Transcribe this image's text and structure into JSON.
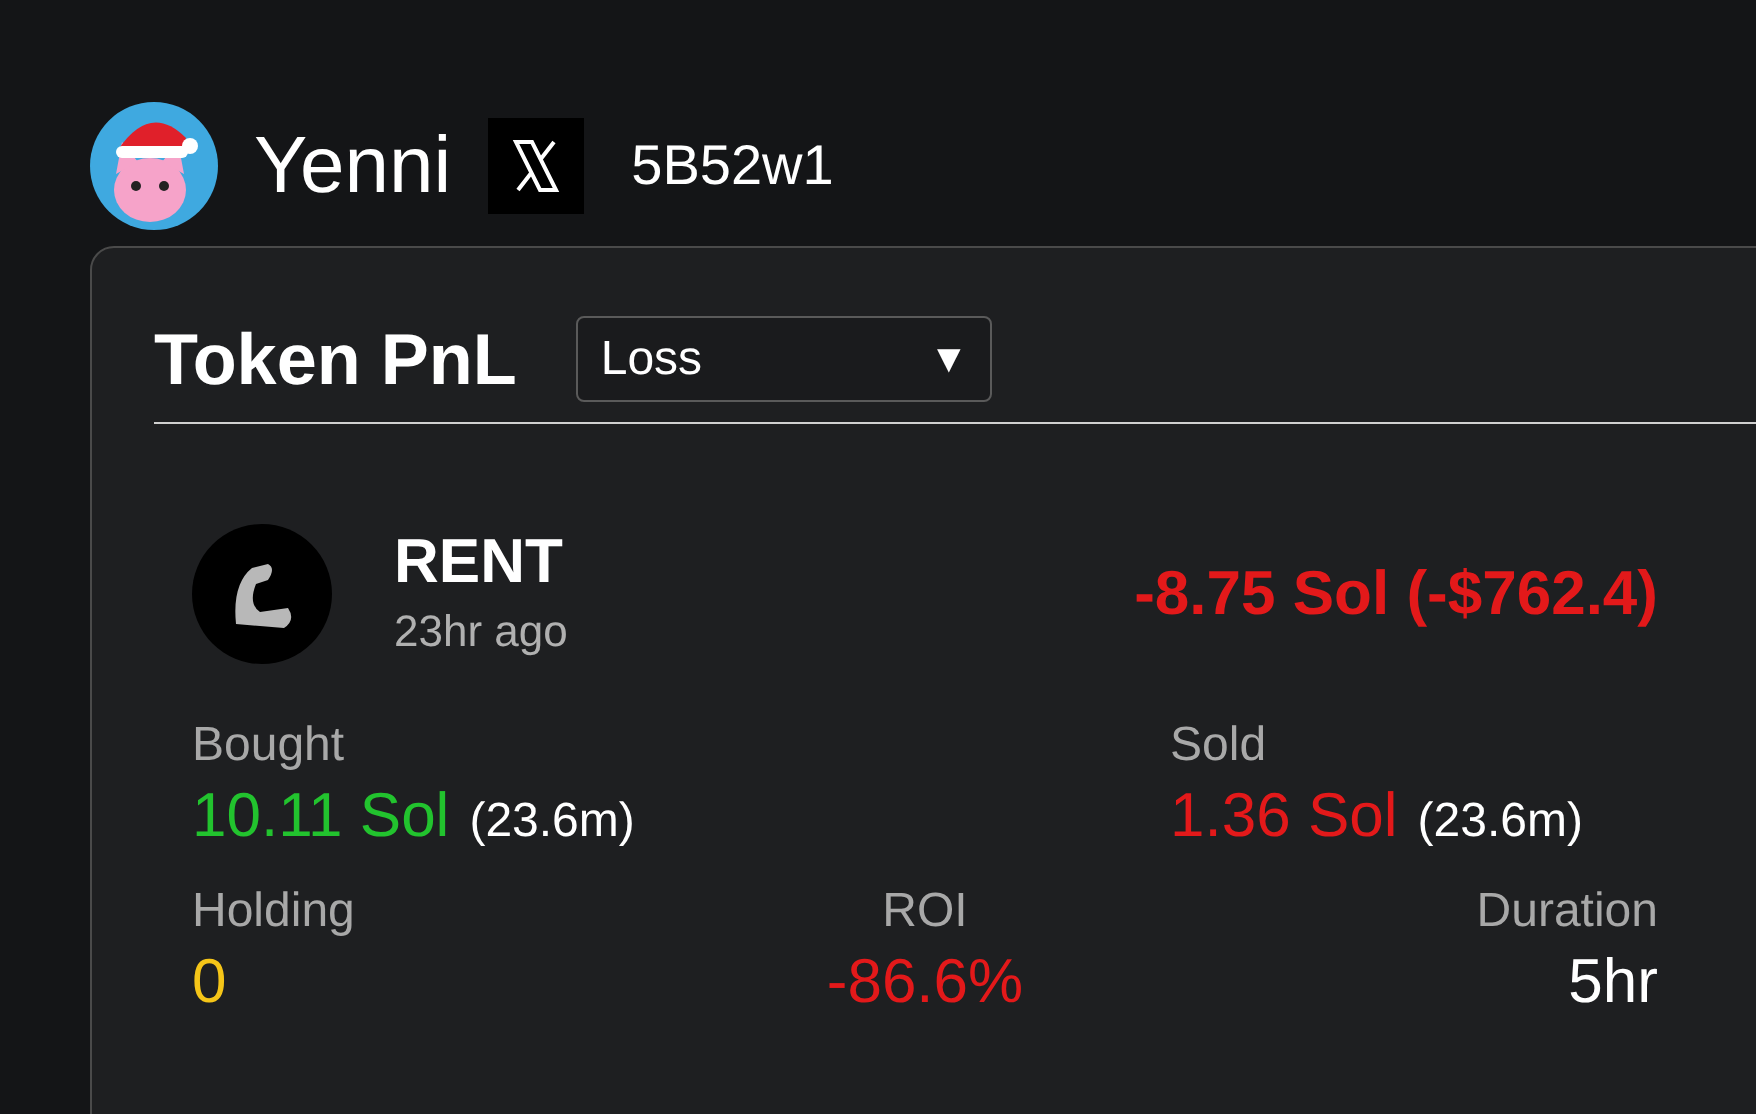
{
  "profile": {
    "name": "Yenni",
    "handle": "5B52w1"
  },
  "card": {
    "title": "Token PnL",
    "filter": {
      "value": "Loss",
      "caret": "▼"
    },
    "token": {
      "symbol": "RENT",
      "time": "23hr ago",
      "pnl": "-8.75 Sol (-$762.4)"
    },
    "stats": [
      {
        "label": "Bought",
        "value": "10.11 Sol",
        "note": "(23.6m)",
        "color": "#22c32e"
      },
      {
        "label": "Sold",
        "value": "1.36 Sol",
        "note": "(23.6m)",
        "color": "#e3191a"
      },
      {
        "label": "Holding",
        "value": "0",
        "color": "#f5c518"
      },
      {
        "label": "ROI",
        "value": "-86.6%",
        "color": "#e3191a"
      },
      {
        "label": "Duration",
        "value": "5hr",
        "color": "#ffffff"
      }
    ]
  }
}
